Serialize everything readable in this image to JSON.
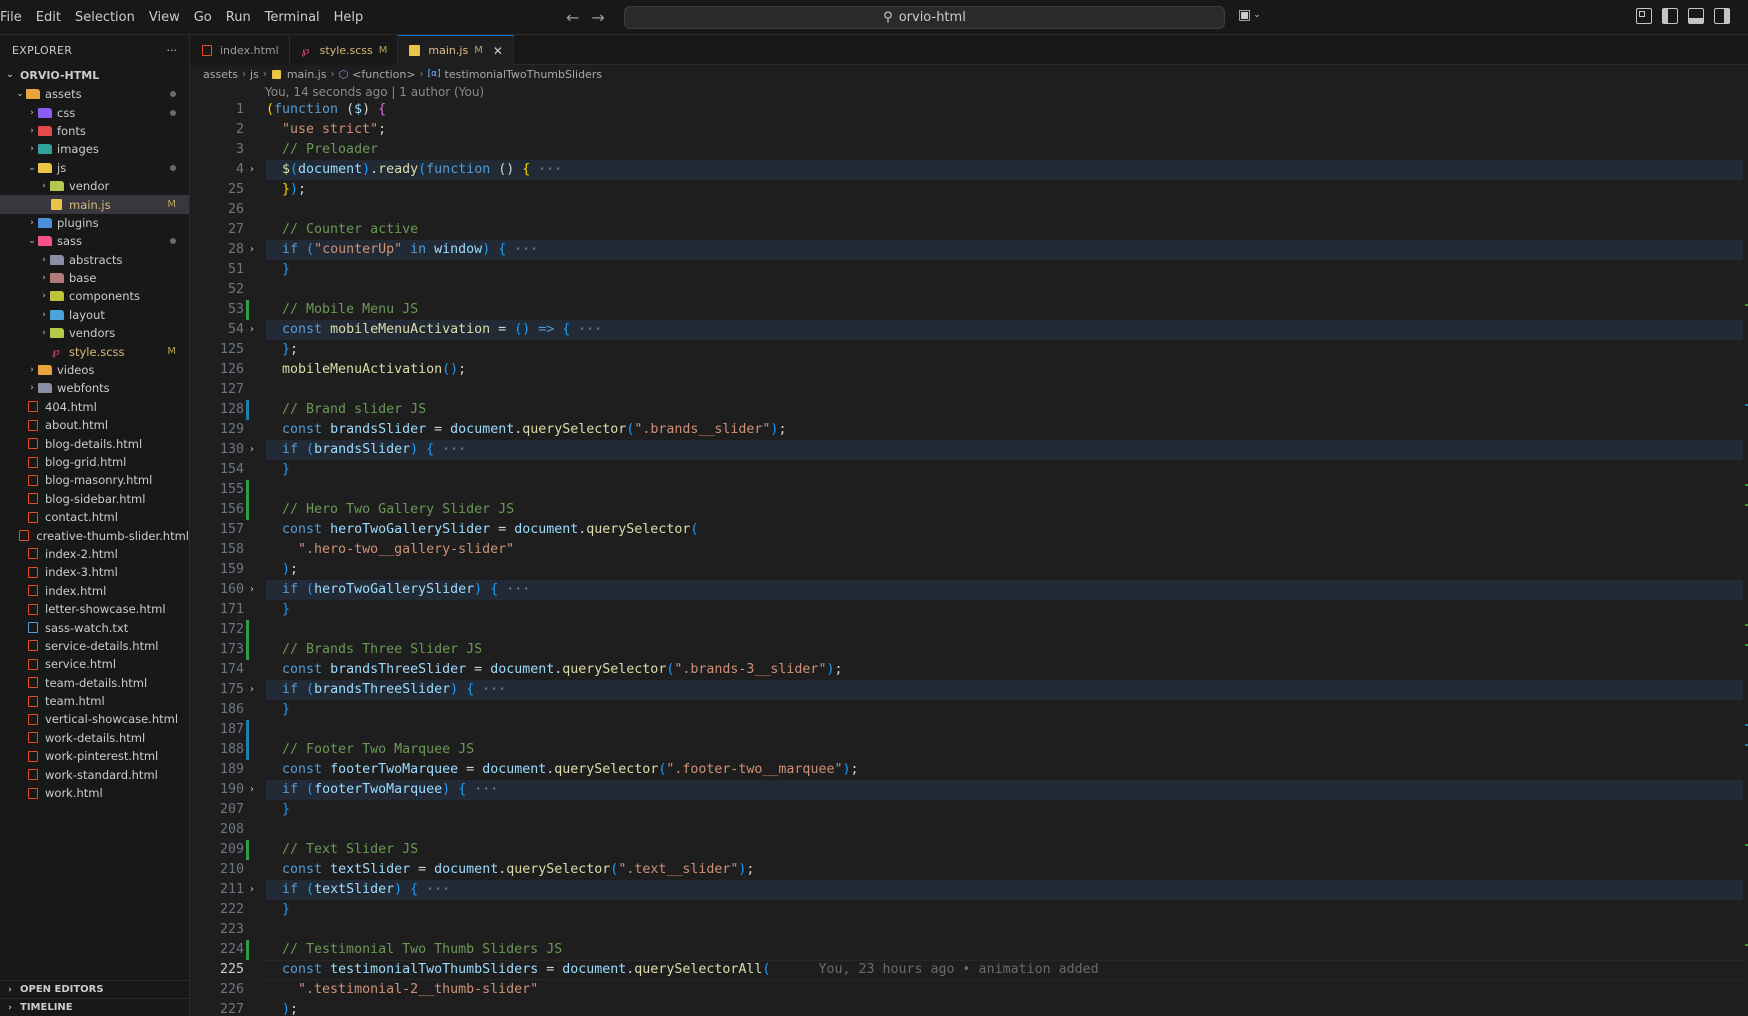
{
  "menu": [
    "File",
    "Edit",
    "Selection",
    "View",
    "Go",
    "Run",
    "Terminal",
    "Help"
  ],
  "command_center": {
    "text": "orvio-html"
  },
  "sidebar": {
    "title": "EXPLORER",
    "more": "···",
    "root": "ORVIO-HTML",
    "tree": [
      {
        "label": "assets",
        "depth": 1,
        "type": "folder",
        "open": true,
        "icon_color": "#e8a33d",
        "dot": true
      },
      {
        "label": "css",
        "depth": 2,
        "type": "folder",
        "open": false,
        "icon_color": "#8a5cf5",
        "dot": true
      },
      {
        "label": "fonts",
        "depth": 2,
        "type": "folder",
        "open": false,
        "icon_color": "#e5484d"
      },
      {
        "label": "images",
        "depth": 2,
        "type": "folder",
        "open": false,
        "icon_color": "#2fa39a"
      },
      {
        "label": "js",
        "depth": 2,
        "type": "folder",
        "open": true,
        "icon_color": "#e8c547",
        "dot": true
      },
      {
        "label": "vendor",
        "depth": 3,
        "type": "folder",
        "open": false,
        "icon_color": "#b5c94a"
      },
      {
        "label": "main.js",
        "depth": 3,
        "type": "js",
        "selected": true,
        "mod": "M"
      },
      {
        "label": "plugins",
        "depth": 2,
        "type": "folder",
        "open": false,
        "icon_color": "#4a90d9"
      },
      {
        "label": "sass",
        "depth": 2,
        "type": "folder",
        "open": true,
        "icon_color": "#f55385",
        "dot": true
      },
      {
        "label": "abstracts",
        "depth": 3,
        "type": "folder",
        "open": false,
        "icon_color": "#8a8fa3"
      },
      {
        "label": "base",
        "depth": 3,
        "type": "folder",
        "open": false,
        "icon_color": "#b07a7a"
      },
      {
        "label": "components",
        "depth": 3,
        "type": "folder",
        "open": false,
        "icon_color": "#c0c23a"
      },
      {
        "label": "layout",
        "depth": 3,
        "type": "folder",
        "open": false,
        "icon_color": "#4aa3d9"
      },
      {
        "label": "vendors",
        "depth": 3,
        "type": "folder",
        "open": false,
        "icon_color": "#b5c94a"
      },
      {
        "label": "style.scss",
        "depth": 3,
        "type": "scss",
        "mod": "M"
      },
      {
        "label": "videos",
        "depth": 2,
        "type": "folder",
        "open": false,
        "icon_color": "#e8a33d"
      },
      {
        "label": "webfonts",
        "depth": 2,
        "type": "folder",
        "open": false,
        "icon_color": "#8a8fa3"
      },
      {
        "label": "404.html",
        "depth": 1,
        "type": "html"
      },
      {
        "label": "about.html",
        "depth": 1,
        "type": "html"
      },
      {
        "label": "blog-details.html",
        "depth": 1,
        "type": "html"
      },
      {
        "label": "blog-grid.html",
        "depth": 1,
        "type": "html"
      },
      {
        "label": "blog-masonry.html",
        "depth": 1,
        "type": "html"
      },
      {
        "label": "blog-sidebar.html",
        "depth": 1,
        "type": "html"
      },
      {
        "label": "contact.html",
        "depth": 1,
        "type": "html"
      },
      {
        "label": "creative-thumb-slider.html",
        "depth": 1,
        "type": "html"
      },
      {
        "label": "index-2.html",
        "depth": 1,
        "type": "html"
      },
      {
        "label": "index-3.html",
        "depth": 1,
        "type": "html"
      },
      {
        "label": "index.html",
        "depth": 1,
        "type": "html"
      },
      {
        "label": "letter-showcase.html",
        "depth": 1,
        "type": "html"
      },
      {
        "label": "sass-watch.txt",
        "depth": 1,
        "type": "txt"
      },
      {
        "label": "service-details.html",
        "depth": 1,
        "type": "html"
      },
      {
        "label": "service.html",
        "depth": 1,
        "type": "html"
      },
      {
        "label": "team-details.html",
        "depth": 1,
        "type": "html"
      },
      {
        "label": "team.html",
        "depth": 1,
        "type": "html"
      },
      {
        "label": "vertical-showcase.html",
        "depth": 1,
        "type": "html"
      },
      {
        "label": "work-details.html",
        "depth": 1,
        "type": "html"
      },
      {
        "label": "work-pinterest.html",
        "depth": 1,
        "type": "html"
      },
      {
        "label": "work-standard.html",
        "depth": 1,
        "type": "html"
      },
      {
        "label": "work.html",
        "depth": 1,
        "type": "html"
      }
    ],
    "open_editors": "OPEN EDITORS",
    "timeline": "TIMELINE"
  },
  "tabs": [
    {
      "label": "index.html",
      "icon": "html",
      "mod": "",
      "active": false
    },
    {
      "label": "style.scss",
      "icon": "scss",
      "mod": "M",
      "active": false
    },
    {
      "label": "main.js",
      "icon": "js",
      "mod": "M",
      "active": true,
      "close": "✕"
    }
  ],
  "breadcrumb": [
    "assets",
    "js",
    "main.js",
    "<function>",
    "testimonialTwoThumbSliders"
  ],
  "blame_header": "You, 14 seconds ago | 1 author (You)",
  "inline_blame": "You, 23 hours ago • animation added",
  "colors": {
    "accent": "#0078d4",
    "added": "#2ea043",
    "modified": "#1b81a8"
  },
  "code_lines": [
    {
      "n": "1",
      "t": [
        [
          "(",
          "br1"
        ],
        [
          "function",
          "k"
        ],
        [
          " (",
          "p"
        ],
        [
          "$",
          "v"
        ],
        [
          ") ",
          "p"
        ],
        [
          "{",
          "br2"
        ]
      ]
    },
    {
      "n": "2",
      "t": [
        [
          "  ",
          "p"
        ],
        [
          "\"use strict\"",
          "s"
        ],
        [
          ";",
          "p"
        ]
      ]
    },
    {
      "n": "3",
      "t": [
        [
          "  ",
          "p"
        ],
        [
          "// Preloader",
          "c"
        ]
      ]
    },
    {
      "n": "4",
      "fold": true,
      "t": [
        [
          "  ",
          "p"
        ],
        [
          "$",
          "f"
        ],
        [
          "(",
          "br3"
        ],
        [
          "document",
          "v"
        ],
        [
          ")",
          "br3"
        ],
        [
          ".",
          "p"
        ],
        [
          "ready",
          "f"
        ],
        [
          "(",
          "br3"
        ],
        [
          "function",
          "k"
        ],
        [
          " () ",
          "p"
        ],
        [
          "{",
          "br1"
        ],
        [
          " ···",
          "ell"
        ]
      ]
    },
    {
      "n": "25",
      "t": [
        [
          "  ",
          "p"
        ],
        [
          "}",
          "br1"
        ],
        [
          ")",
          "br3"
        ],
        [
          ";",
          "p"
        ]
      ]
    },
    {
      "n": "26",
      "t": []
    },
    {
      "n": "27",
      "t": [
        [
          "  ",
          "p"
        ],
        [
          "// Counter active",
          "c"
        ]
      ]
    },
    {
      "n": "28",
      "fold": true,
      "t": [
        [
          "  ",
          "p"
        ],
        [
          "if",
          "k"
        ],
        [
          " ",
          "p"
        ],
        [
          "(",
          "br3"
        ],
        [
          "\"counterUp\"",
          "s"
        ],
        [
          " in ",
          "k"
        ],
        [
          "window",
          "v"
        ],
        [
          ")",
          "br3"
        ],
        [
          " ",
          "p"
        ],
        [
          "{",
          "br3"
        ],
        [
          " ···",
          "ell"
        ]
      ]
    },
    {
      "n": "51",
      "t": [
        [
          "  ",
          "p"
        ],
        [
          "}",
          "br3"
        ]
      ]
    },
    {
      "n": "52",
      "t": []
    },
    {
      "n": "53",
      "mark": "added",
      "t": [
        [
          "  ",
          "p"
        ],
        [
          "// Mobile Menu JS",
          "c"
        ]
      ]
    },
    {
      "n": "54",
      "fold": true,
      "t": [
        [
          "  ",
          "p"
        ],
        [
          "const",
          "k"
        ],
        [
          " ",
          "p"
        ],
        [
          "mobileMenuActivation",
          "f"
        ],
        [
          " = ",
          "p"
        ],
        [
          "()",
          "br3"
        ],
        [
          " => ",
          "k"
        ],
        [
          "{",
          "br3"
        ],
        [
          " ···",
          "ell"
        ]
      ]
    },
    {
      "n": "125",
      "t": [
        [
          "  ",
          "p"
        ],
        [
          "}",
          "br3"
        ],
        [
          ";",
          "p"
        ]
      ]
    },
    {
      "n": "126",
      "t": [
        [
          "  ",
          "p"
        ],
        [
          "mobileMenuActivation",
          "f"
        ],
        [
          "()",
          "br3"
        ],
        [
          ";",
          "p"
        ]
      ]
    },
    {
      "n": "127",
      "t": []
    },
    {
      "n": "128",
      "mark": "modified",
      "t": [
        [
          "  ",
          "p"
        ],
        [
          "// Brand slider JS",
          "c"
        ]
      ]
    },
    {
      "n": "129",
      "t": [
        [
          "  ",
          "p"
        ],
        [
          "const",
          "k"
        ],
        [
          " ",
          "p"
        ],
        [
          "brandsSlider",
          "v"
        ],
        [
          " = ",
          "p"
        ],
        [
          "document",
          "v"
        ],
        [
          ".",
          "p"
        ],
        [
          "querySelector",
          "f"
        ],
        [
          "(",
          "br3"
        ],
        [
          "\".brands__slider\"",
          "s"
        ],
        [
          ")",
          "br3"
        ],
        [
          ";",
          "p"
        ]
      ]
    },
    {
      "n": "130",
      "fold": true,
      "t": [
        [
          "  ",
          "p"
        ],
        [
          "if",
          "k"
        ],
        [
          " ",
          "p"
        ],
        [
          "(",
          "br3"
        ],
        [
          "brandsSlider",
          "v"
        ],
        [
          ")",
          "br3"
        ],
        [
          " ",
          "p"
        ],
        [
          "{",
          "br3"
        ],
        [
          " ···",
          "ell"
        ]
      ]
    },
    {
      "n": "154",
      "t": [
        [
          "  ",
          "p"
        ],
        [
          "}",
          "br3"
        ]
      ]
    },
    {
      "n": "155",
      "mark": "added",
      "t": []
    },
    {
      "n": "156",
      "mark": "added",
      "t": [
        [
          "  ",
          "p"
        ],
        [
          "// Hero Two Gallery Slider JS",
          "c"
        ]
      ]
    },
    {
      "n": "157",
      "t": [
        [
          "  ",
          "p"
        ],
        [
          "const",
          "k"
        ],
        [
          " ",
          "p"
        ],
        [
          "heroTwoGallerySlider",
          "v"
        ],
        [
          " = ",
          "p"
        ],
        [
          "document",
          "v"
        ],
        [
          ".",
          "p"
        ],
        [
          "querySelector",
          "f"
        ],
        [
          "(",
          "br3"
        ]
      ]
    },
    {
      "n": "158",
      "t": [
        [
          "    ",
          "p"
        ],
        [
          "\".hero-two__gallery-slider\"",
          "s"
        ]
      ]
    },
    {
      "n": "159",
      "t": [
        [
          "  ",
          "p"
        ],
        [
          ")",
          "br3"
        ],
        [
          ";",
          "p"
        ]
      ]
    },
    {
      "n": "160",
      "fold": true,
      "t": [
        [
          "  ",
          "p"
        ],
        [
          "if",
          "k"
        ],
        [
          " ",
          "p"
        ],
        [
          "(",
          "br3"
        ],
        [
          "heroTwoGallerySlider",
          "v"
        ],
        [
          ")",
          "br3"
        ],
        [
          " ",
          "p"
        ],
        [
          "{",
          "br3"
        ],
        [
          " ···",
          "ell"
        ]
      ]
    },
    {
      "n": "171",
      "t": [
        [
          "  ",
          "p"
        ],
        [
          "}",
          "br3"
        ]
      ]
    },
    {
      "n": "172",
      "mark": "added",
      "t": []
    },
    {
      "n": "173",
      "mark": "added",
      "t": [
        [
          "  ",
          "p"
        ],
        [
          "// Brands Three Slider JS",
          "c"
        ]
      ]
    },
    {
      "n": "174",
      "t": [
        [
          "  ",
          "p"
        ],
        [
          "const",
          "k"
        ],
        [
          " ",
          "p"
        ],
        [
          "brandsThreeSlider",
          "v"
        ],
        [
          " = ",
          "p"
        ],
        [
          "document",
          "v"
        ],
        [
          ".",
          "p"
        ],
        [
          "querySelector",
          "f"
        ],
        [
          "(",
          "br3"
        ],
        [
          "\".brands-3__slider\"",
          "s"
        ],
        [
          ")",
          "br3"
        ],
        [
          ";",
          "p"
        ]
      ]
    },
    {
      "n": "175",
      "fold": true,
      "t": [
        [
          "  ",
          "p"
        ],
        [
          "if",
          "k"
        ],
        [
          " ",
          "p"
        ],
        [
          "(",
          "br3"
        ],
        [
          "brandsThreeSlider",
          "v"
        ],
        [
          ")",
          "br3"
        ],
        [
          " ",
          "p"
        ],
        [
          "{",
          "br3"
        ],
        [
          " ···",
          "ell"
        ]
      ]
    },
    {
      "n": "186",
      "t": [
        [
          "  ",
          "p"
        ],
        [
          "}",
          "br3"
        ]
      ]
    },
    {
      "n": "187",
      "mark": "modified",
      "t": []
    },
    {
      "n": "188",
      "mark": "modified",
      "t": [
        [
          "  ",
          "p"
        ],
        [
          "// Footer Two Marquee JS",
          "c"
        ]
      ]
    },
    {
      "n": "189",
      "t": [
        [
          "  ",
          "p"
        ],
        [
          "const",
          "k"
        ],
        [
          " ",
          "p"
        ],
        [
          "footerTwoMarquee",
          "v"
        ],
        [
          " = ",
          "p"
        ],
        [
          "document",
          "v"
        ],
        [
          ".",
          "p"
        ],
        [
          "querySelector",
          "f"
        ],
        [
          "(",
          "br3"
        ],
        [
          "\".footer-two__marquee\"",
          "s"
        ],
        [
          ")",
          "br3"
        ],
        [
          ";",
          "p"
        ]
      ]
    },
    {
      "n": "190",
      "fold": true,
      "t": [
        [
          "  ",
          "p"
        ],
        [
          "if",
          "k"
        ],
        [
          " ",
          "p"
        ],
        [
          "(",
          "br3"
        ],
        [
          "footerTwoMarquee",
          "v"
        ],
        [
          ")",
          "br3"
        ],
        [
          " ",
          "p"
        ],
        [
          "{",
          "br3"
        ],
        [
          " ···",
          "ell"
        ]
      ]
    },
    {
      "n": "207",
      "t": [
        [
          "  ",
          "p"
        ],
        [
          "}",
          "br3"
        ]
      ]
    },
    {
      "n": "208",
      "t": []
    },
    {
      "n": "209",
      "mark": "added",
      "t": [
        [
          "  ",
          "p"
        ],
        [
          "// Text Slider JS",
          "c"
        ]
      ]
    },
    {
      "n": "210",
      "t": [
        [
          "  ",
          "p"
        ],
        [
          "const",
          "k"
        ],
        [
          " ",
          "p"
        ],
        [
          "textSlider",
          "v"
        ],
        [
          " = ",
          "p"
        ],
        [
          "document",
          "v"
        ],
        [
          ".",
          "p"
        ],
        [
          "querySelector",
          "f"
        ],
        [
          "(",
          "br3"
        ],
        [
          "\".text__slider\"",
          "s"
        ],
        [
          ")",
          "br3"
        ],
        [
          ";",
          "p"
        ]
      ]
    },
    {
      "n": "211",
      "fold": true,
      "t": [
        [
          "  ",
          "p"
        ],
        [
          "if",
          "k"
        ],
        [
          " ",
          "p"
        ],
        [
          "(",
          "br3"
        ],
        [
          "textSlider",
          "v"
        ],
        [
          ")",
          "br3"
        ],
        [
          " ",
          "p"
        ],
        [
          "{",
          "br3"
        ],
        [
          " ···",
          "ell"
        ]
      ]
    },
    {
      "n": "222",
      "t": [
        [
          "  ",
          "p"
        ],
        [
          "}",
          "br3"
        ]
      ]
    },
    {
      "n": "223",
      "t": []
    },
    {
      "n": "224",
      "mark": "added",
      "t": [
        [
          "  ",
          "p"
        ],
        [
          "// Testimonial Two Thumb Sliders JS",
          "c"
        ]
      ]
    },
    {
      "n": "225",
      "current": true,
      "blame": true,
      "t": [
        [
          "  ",
          "p"
        ],
        [
          "const",
          "k"
        ],
        [
          " ",
          "p"
        ],
        [
          "testimonialTwoThumbSliders",
          "v"
        ],
        [
          " = ",
          "p"
        ],
        [
          "document",
          "v"
        ],
        [
          ".",
          "p"
        ],
        [
          "querySelectorAll",
          "f"
        ],
        [
          "(",
          "br3"
        ]
      ]
    },
    {
      "n": "226",
      "t": [
        [
          "    ",
          "p"
        ],
        [
          "\".testimonial-2__thumb-slider\"",
          "s"
        ]
      ]
    },
    {
      "n": "227",
      "t": [
        [
          "  ",
          "p"
        ],
        [
          ")",
          "br3"
        ],
        [
          ";",
          "p"
        ]
      ]
    }
  ]
}
